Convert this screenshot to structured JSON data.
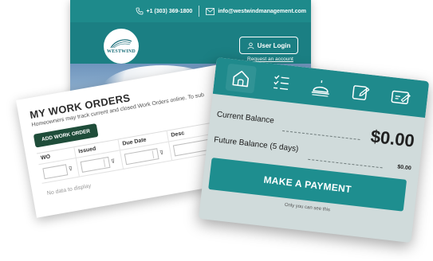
{
  "site": {
    "phone": "+1 (303) 369-1800",
    "email": "info@westwindmanagement.com",
    "logo_text": "WESTWIND",
    "login_label": "User Login",
    "request_link": "Request an account"
  },
  "work_orders": {
    "title": "MY WORK ORDERS",
    "description": "Homeowners may track current and closed Work Orders online. To sub",
    "add_button": "ADD WORK ORDER",
    "columns": [
      "WO",
      "Issued",
      "Due Date",
      "Desc"
    ],
    "empty_text": "No data to display"
  },
  "balance": {
    "nav_icons": [
      "home-icon",
      "checklist-icon",
      "service-bell-icon",
      "tablet-edit-icon",
      "payment-card-icon"
    ],
    "current_label": "Current Balance",
    "current_value": "$0.00",
    "future_label": "Future Balance (5 days)",
    "future_value": "$0.00",
    "pay_button": "MAKE A PAYMENT",
    "pay_note": "Only you can see this"
  },
  "colors": {
    "teal": "#1e8a8b",
    "dark_green": "#1f4d3a",
    "panel_gray": "#d0dbdb"
  }
}
